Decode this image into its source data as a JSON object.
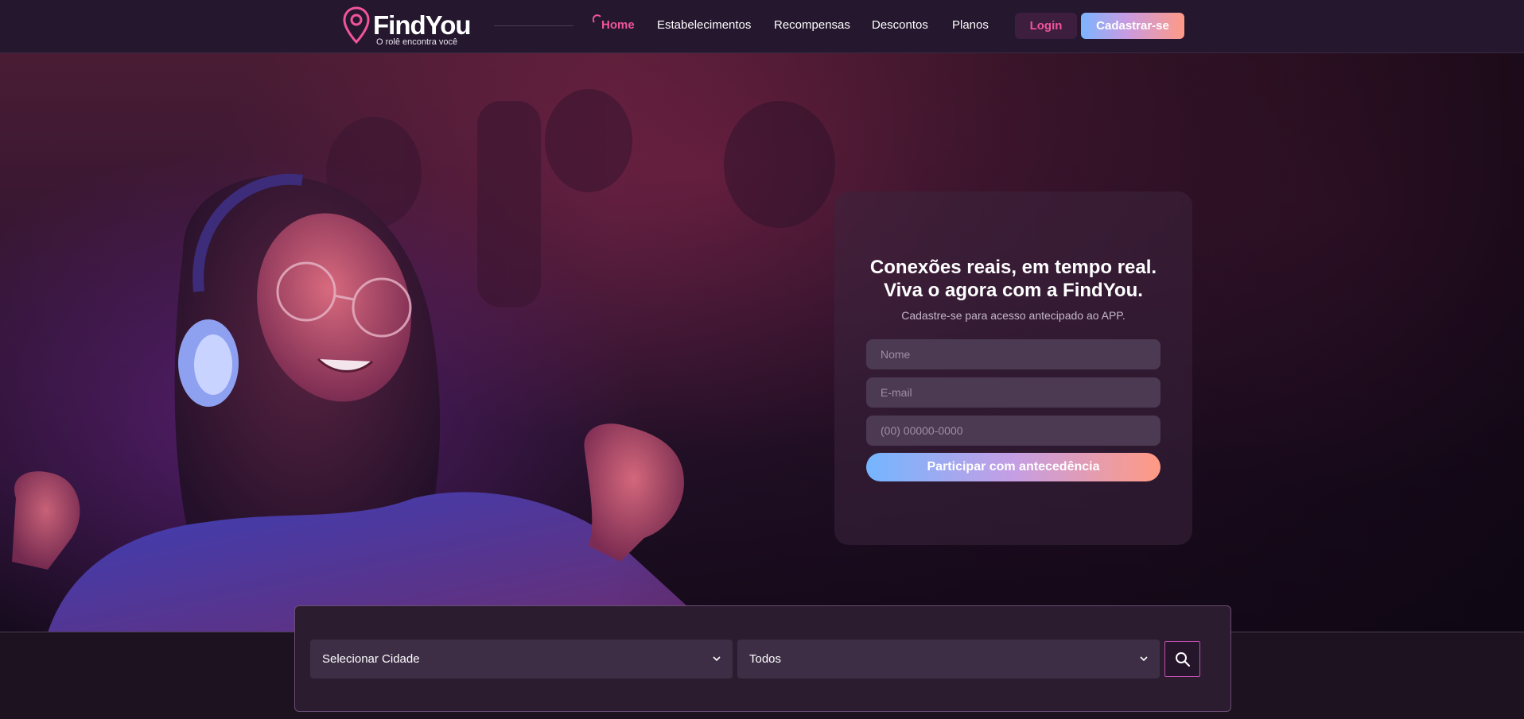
{
  "brand": {
    "name": "FindYou",
    "tagline": "O rolê encontra você",
    "accent": "#f0559a"
  },
  "nav": {
    "items": [
      {
        "label": "Home",
        "active": true
      },
      {
        "label": "Estabelecimentos",
        "active": false
      },
      {
        "label": "Recompensas",
        "active": false
      },
      {
        "label": "Descontos",
        "active": false
      },
      {
        "label": "Planos",
        "active": false
      }
    ],
    "login_label": "Login",
    "signup_label": "Cadastrar-se"
  },
  "hero": {
    "image": "woman-with-headphones-dancing"
  },
  "signup_card": {
    "title_line1": "Conexões reais, em tempo real.",
    "title_line2": "Viva o agora com a FindYou.",
    "subtitle": "Cadastre-se para acesso antecipado ao APP.",
    "name_placeholder": "Nome",
    "email_placeholder": "E-mail",
    "phone_placeholder": "(00) 00000-0000",
    "submit_label": "Participar com antecedência"
  },
  "search": {
    "city_select": "Selecionar Cidade",
    "type_select": "Todos",
    "search_icon": "search-icon"
  }
}
